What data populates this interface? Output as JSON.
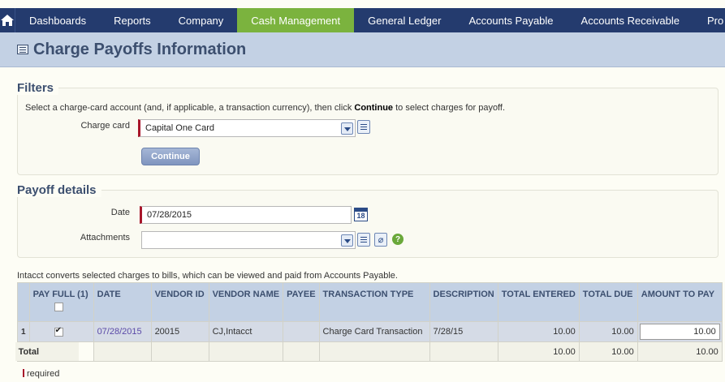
{
  "nav": {
    "items": [
      {
        "label": "Dashboards",
        "active": false
      },
      {
        "label": "Reports",
        "active": false
      },
      {
        "label": "Company",
        "active": false
      },
      {
        "label": "Cash Management",
        "active": true
      },
      {
        "label": "General Ledger",
        "active": false
      },
      {
        "label": "Accounts Payable",
        "active": false
      },
      {
        "label": "Accounts Receivable",
        "active": false
      },
      {
        "label": "Pro",
        "active": false
      }
    ]
  },
  "page": {
    "title": "Charge Payoffs Information"
  },
  "filters": {
    "title": "Filters",
    "instruction_pre": "Select a charge-card account (and, if applicable, a transaction currency), then click ",
    "instruction_bold": "Continue",
    "instruction_post": " to select charges for payoff.",
    "charge_card_label": "Charge card",
    "charge_card_value": "Capital One Card",
    "continue_label": "Continue"
  },
  "payoff": {
    "title": "Payoff details",
    "date_label": "Date",
    "date_value": "07/28/2015",
    "calendar_day": "18",
    "attachments_label": "Attachments",
    "attachments_value": ""
  },
  "note": "Intacct converts selected charges to bills, which can be viewed and paid from Accounts Payable.",
  "table": {
    "headers": [
      "",
      "PAY FULL (1)",
      "DATE",
      "VENDOR ID",
      "VENDOR NAME",
      "PAYEE",
      "TRANSACTION TYPE",
      "DESCRIPTION",
      "TOTAL ENTERED",
      "TOTAL DUE",
      "AMOUNT TO PAY"
    ],
    "row": {
      "num": "1",
      "date": "07/28/2015",
      "vendor_id": "20015",
      "vendor_name": "CJ,Intacct",
      "payee": "",
      "transaction_type": "Charge Card Transaction",
      "description": "7/28/15",
      "total_entered": "10.00",
      "total_due": "10.00",
      "amount_to_pay": "10.00"
    },
    "total": {
      "label": "Total",
      "total_entered": "10.00",
      "total_due": "10.00",
      "amount_to_pay": "10.00"
    }
  },
  "required_label": "required",
  "colors": {
    "nav_bg": "#243b6e",
    "nav_active": "#7bb33e",
    "header_bg": "#c3d1e4",
    "required_marker": "#a8152a"
  }
}
